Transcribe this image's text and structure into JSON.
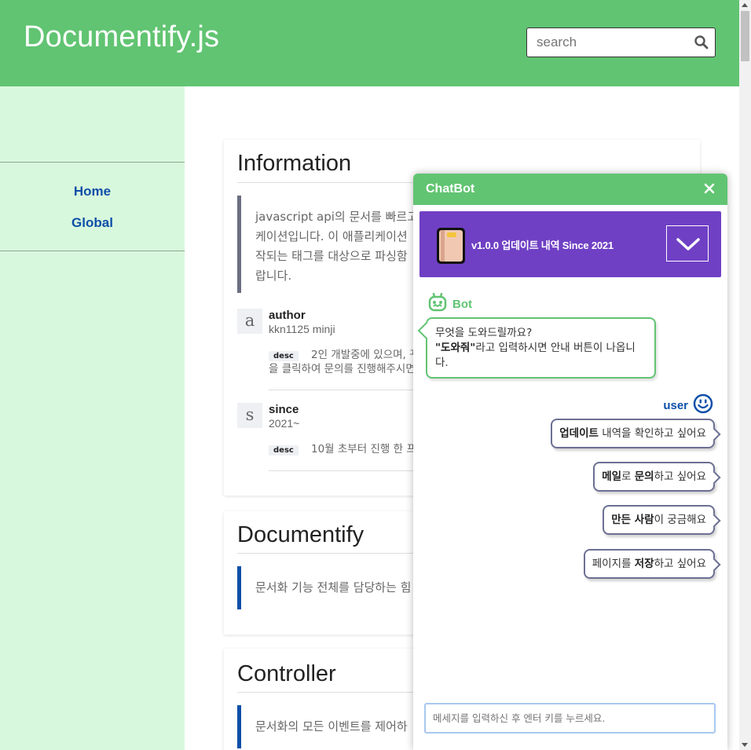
{
  "header": {
    "brand": "Documentify.js",
    "search_placeholder": "search"
  },
  "sidebar": {
    "items": [
      {
        "label": "Home"
      },
      {
        "label": "Global"
      }
    ]
  },
  "sections": {
    "information": {
      "title": "Information",
      "desc_lines": [
        "javascript api의 문서를 빠르고",
        "케이션입니다. 이 애플리케이션",
        "작되는 태그를 대상으로 파싱함",
        "랍니다."
      ],
      "meta": [
        {
          "letter": "a",
          "name": "author",
          "value": "kkn1125 minji",
          "badge": "desc",
          "desc_line1": "2인 개발중에 있으며, 꾸",
          "desc_line2": "을 클릭하여 문의를 진행해주시면"
        },
        {
          "letter": "s",
          "name": "since",
          "value": "2021~",
          "badge": "desc",
          "desc_line1": "10월 초부터 진행 한 프"
        }
      ]
    },
    "documentify": {
      "title": "Documentify",
      "desc": "문서화 기능 전체를 담당하는 힘"
    },
    "controller": {
      "title": "Controller",
      "desc": "문서화의 모든 이벤트를 제어하"
    }
  },
  "chatbot": {
    "title": "ChatBot",
    "close_icon": "close-icon",
    "update_bar": {
      "text": "v1.0.0 업데이트 내역 Since 2021",
      "icon": "book-icon",
      "toggle_icon": "chevron-down-icon"
    },
    "bot": {
      "name": "Bot",
      "line1": "무엇을 도와드릴까요?",
      "line2_bold": "\"도와줘\"",
      "line2_rest": "라고 입력하시면 안내 버튼이 나옵니다."
    },
    "user": {
      "name": "user"
    },
    "options": [
      {
        "bold": "업데이트",
        "rest": " 내역을 확인하고 싶어요"
      },
      {
        "bold1": "메일",
        "mid": "로 ",
        "bold2": "문의",
        "rest": "하고 싶어요"
      },
      {
        "bold": "만든 사람",
        "rest": "이 궁금해요"
      },
      {
        "pre": "페이지를 ",
        "bold": "저장",
        "rest": "하고 싶어요"
      }
    ],
    "input_placeholder": "메세지를 입력하신 후 엔터 키를 누르세요."
  },
  "colors": {
    "header_green": "#61c472",
    "sidebar_bg": "#d8f8dd",
    "link_blue": "#0d4fa8",
    "update_purple": "#6f40c4"
  }
}
